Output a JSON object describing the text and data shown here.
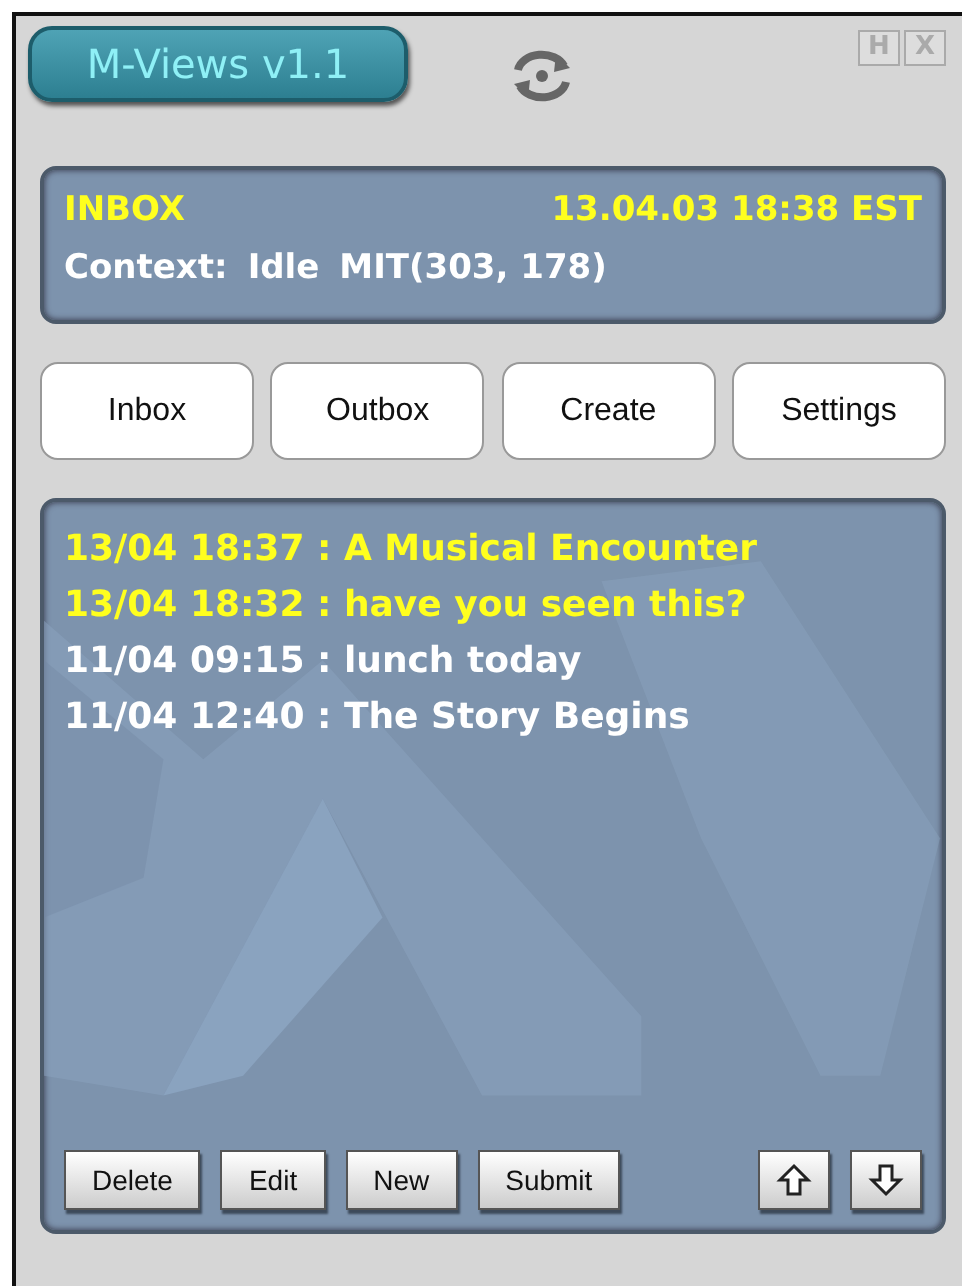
{
  "app": {
    "title": "M-Views v1.1",
    "window_buttons": [
      "H",
      "X"
    ]
  },
  "status": {
    "folder": "INBOX",
    "datetime": "13.04.03 18:38 EST",
    "context_label": "Context:",
    "context": "Idle",
    "location": "MIT(303, 178)"
  },
  "nav_buttons": [
    "Inbox",
    "Outbox",
    "Create",
    "Settings"
  ],
  "messages": [
    {
      "text": "13/04 18:37 : A Musical Encounter",
      "unread": true
    },
    {
      "text": "13/04 18:32 : have you seen this?",
      "unread": true
    },
    {
      "text": "11/04 09:15 : lunch today",
      "unread": false
    },
    {
      "text": "11/04 12:40 : The Story Begins",
      "unread": false
    }
  ],
  "actions": [
    "Delete",
    "Edit",
    "New",
    "Submit"
  ],
  "scroll_buttons": [
    {
      "kind": "up"
    },
    {
      "kind": "down"
    }
  ]
}
